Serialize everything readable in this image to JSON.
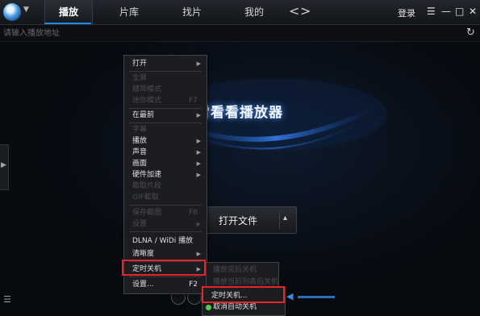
{
  "tabs": [
    {
      "label": "播放",
      "active": true
    },
    {
      "label": "片库",
      "active": false
    },
    {
      "label": "找片",
      "active": false
    },
    {
      "label": "我的",
      "active": false
    }
  ],
  "nav": {
    "back": "<",
    "forward": ">"
  },
  "header": {
    "login": "登录"
  },
  "window_buttons": {
    "menu": "☰",
    "minimize": "—",
    "maximize": "□",
    "close": "✕"
  },
  "urlbar": {
    "placeholder": "请输入播放地址",
    "refresh": "↻"
  },
  "brand": {
    "title": "迅雷看看播放器"
  },
  "open_file": {
    "label": "打开文件",
    "caret": "▴"
  },
  "context_menu": {
    "items": [
      {
        "label": "打开",
        "submenu": true,
        "enabled": true
      },
      {
        "label": "全屏",
        "submenu": false,
        "enabled": false
      },
      {
        "label": "精简模式",
        "submenu": false,
        "enabled": false
      },
      {
        "label": "迷你模式",
        "submenu": false,
        "enabled": false,
        "shortcut": "F7"
      },
      {
        "label": "在最前",
        "submenu": true,
        "enabled": true
      },
      {
        "label": "字幕",
        "submenu": false,
        "enabled": false
      },
      {
        "label": "播放",
        "submenu": true,
        "enabled": true
      },
      {
        "label": "声音",
        "submenu": true,
        "enabled": true
      },
      {
        "label": "画面",
        "submenu": true,
        "enabled": true
      },
      {
        "label": "硬件加速",
        "submenu": true,
        "enabled": true
      },
      {
        "label": "截取片段",
        "submenu": false,
        "enabled": false
      },
      {
        "label": "GIF截取",
        "submenu": false,
        "enabled": false
      },
      {
        "label": "保存截图",
        "submenu": false,
        "enabled": false,
        "shortcut": "F8"
      },
      {
        "label": "设置",
        "submenu": true,
        "enabled": false
      },
      {
        "label": "DLNA / WiDi 播放",
        "submenu": false,
        "enabled": true
      },
      {
        "label": "清晰度",
        "submenu": true,
        "enabled": true
      },
      {
        "label": "定时关机",
        "submenu": true,
        "enabled": true,
        "highlighted": true
      },
      {
        "label": "设置...",
        "submenu": false,
        "enabled": true,
        "shortcut": "F2"
      }
    ]
  },
  "shutdown_submenu": {
    "items": [
      {
        "label": "播放完后关机",
        "enabled": false
      },
      {
        "label": "播放当前列表后关机",
        "enabled": false
      },
      {
        "label": "定时关机...",
        "enabled": true,
        "highlighted": true
      },
      {
        "label": "取消自动关机",
        "enabled": true,
        "icon": "green-dot-icon"
      }
    ]
  },
  "colors": {
    "accent": "#1f86e8",
    "highlight_box": "#e3262b",
    "menu_bg": "#1b1d21"
  }
}
